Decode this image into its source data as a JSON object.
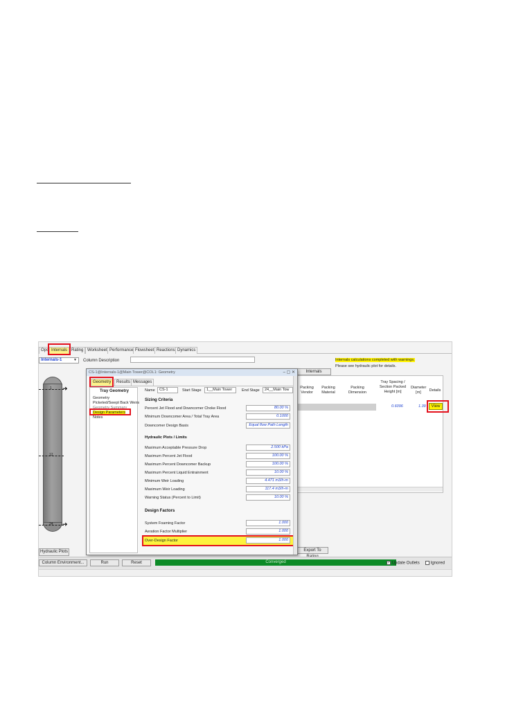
{
  "window": {
    "tabs": [
      {
        "label": "Ops",
        "active": false
      },
      {
        "label": "Internals",
        "active": true
      },
      {
        "label": "Rating",
        "active": false
      },
      {
        "label": "Worksheet",
        "active": false
      },
      {
        "label": "Performance",
        "active": false
      },
      {
        "label": "Flowsheet",
        "active": false
      },
      {
        "label": "Reactions",
        "active": false
      },
      {
        "label": "Dynamics",
        "active": false
      }
    ],
    "internals_select": "Internals-1",
    "column_description_label": "Column Description"
  },
  "column": {
    "stage_top": "1",
    "stage_mid": "12",
    "stage_bottom": "24"
  },
  "left_buttons": {
    "hydraulic_plots": "Hydraulic Plots"
  },
  "main_panel": {
    "internals_summary_button": "Internals Summary",
    "warning_text": "Internals calculations completed with warnings.",
    "hint_text": "Please see hydraulic plot for details.",
    "headers": [
      "Packing Vendor",
      "Packing Material",
      "Packing Dimension",
      "Tray Spacing / Section Packed Height [m]",
      "Diameter [m]",
      "Details"
    ],
    "row": {
      "tray_spacing": "0.6096",
      "diameter": "1.39",
      "view_button": "View"
    },
    "export_button": "Export To Rating"
  },
  "dialog": {
    "title": "CS-1@Internals-1@Main Tower@COL1: Geometry",
    "tabs": [
      {
        "label": "Geometry",
        "active": true
      },
      {
        "label": "Results",
        "active": false
      },
      {
        "label": "Messages",
        "active": false
      }
    ],
    "nav_title": "Tray Geometry",
    "nav_items": [
      "Geometry",
      "Picketed/Swept Back Weirs",
      "Geometry Summary",
      "Design Parameters",
      "Notes"
    ],
    "name_label": "Name",
    "name_value": "CS-1",
    "start_stage_label": "Start Stage",
    "start_stage_value": "1__Main Tower",
    "end_stage_label": "End Stage",
    "end_stage_value": "24__Main Tow",
    "sections": {
      "sizing": "Sizing Criteria",
      "hydraulic": "Hydraulic Plots / Limits",
      "design": "Design Factors"
    },
    "sizing_rows": [
      {
        "label": "Percent Jet Flood and Downcomer Choke Flood",
        "value": "80.00 %"
      },
      {
        "label": "Minimum Downcomer Area / Total Tray Area",
        "value": "0.1000"
      },
      {
        "label": "Downcomer Design Basis",
        "value": "Equal flow Path Length"
      }
    ],
    "hydraulic_rows": [
      {
        "label": "Maximum Acceptable Pressure Drop",
        "value": "2.500 kPa"
      },
      {
        "label": "Maximum Percent Jet Flood",
        "value": "100.00 %"
      },
      {
        "label": "Maximum Percent Downcomer Backup",
        "value": "100.00 %"
      },
      {
        "label": "Maximum Percent Liquid Entrainment",
        "value": "10.00 %"
      },
      {
        "label": "Minimum Weir Loading",
        "value": "4.471 m3/h-m"
      },
      {
        "label": "Maximum Weir Loading",
        "value": "117.4 m3/h-m"
      },
      {
        "label": "Warning Status (Percent to Limit)",
        "value": "10.00 %"
      }
    ],
    "design_rows": [
      {
        "label": "System Foaming Factor",
        "value": "1.000"
      },
      {
        "label": "Aeration Factor Multiplier",
        "value": "1.000"
      },
      {
        "label": "Over-Design Factor",
        "value": "1.000"
      }
    ]
  },
  "bottom_bar": {
    "column_env_button": "Column Environment...",
    "run_button": "Run",
    "reset_button": "Reset",
    "status": "Converged",
    "update_outlets": "Update Outlets",
    "ignored": "Ignored"
  },
  "colors": {
    "highlight": "#fff200",
    "annotation_red": "#e3101c",
    "converged_green": "#0c8a26",
    "value_blue": "#1a3fd0"
  }
}
